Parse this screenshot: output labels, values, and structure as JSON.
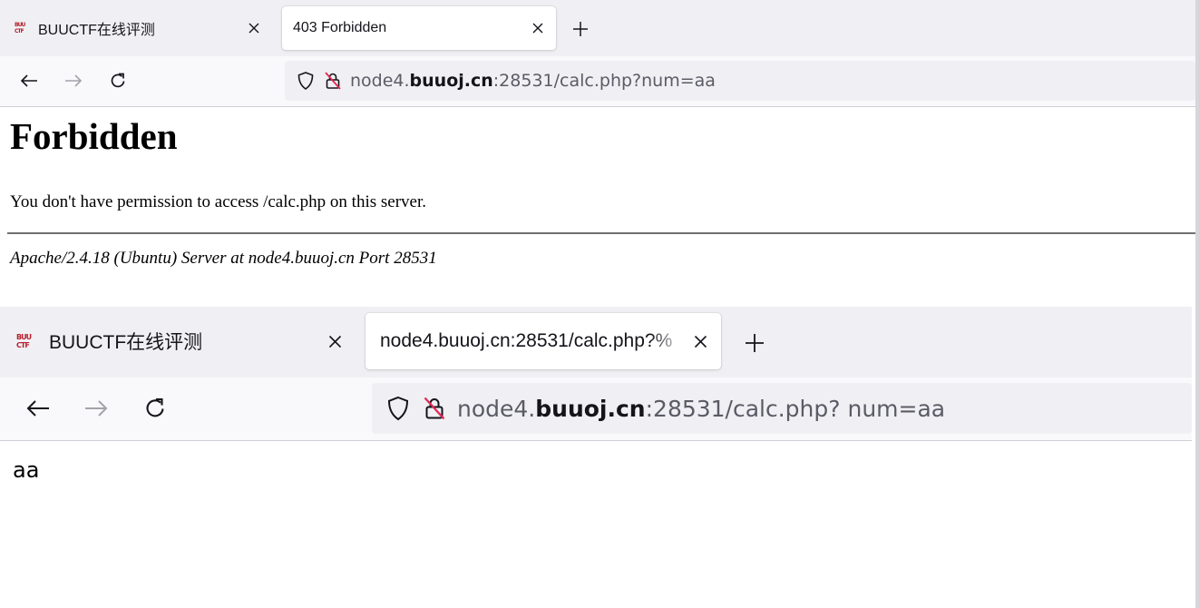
{
  "window1": {
    "tabs": [
      {
        "favicon": "BUU CTF",
        "title": "BUUCTF在线评测",
        "active": false
      },
      {
        "title": "403 Forbidden",
        "active": true
      }
    ],
    "urlbar": {
      "host_prefix": "node4.",
      "host_domain": "buuoj.cn",
      "host_rest": ":28531/calc.php?num=aa"
    },
    "page": {
      "heading": "Forbidden",
      "message": "You don't have permission to access /calc.php on this server.",
      "server_signature": "Apache/2.4.18 (Ubuntu) Server at node4.buuoj.cn Port 28531"
    }
  },
  "window2": {
    "tabs": [
      {
        "favicon": "BUU CTF",
        "title": "BUUCTF在线评测",
        "active": false
      },
      {
        "title": "node4.buuoj.cn:28531/calc.php?%",
        "active": true
      }
    ],
    "urlbar": {
      "host_prefix": "node4.",
      "host_domain": "buuoj.cn",
      "host_rest": ":28531/calc.php? num=aa"
    },
    "page": {
      "text": "aa"
    }
  },
  "icons": {
    "back": "arrow-left-icon",
    "forward": "arrow-right-icon",
    "reload": "reload-icon",
    "shield": "shield-icon",
    "insecure": "insecure-lock-icon",
    "close": "close-icon",
    "newtab": "plus-icon"
  },
  "colors": {
    "tabstrip": "#f0f0f4",
    "navbar": "#f9f9fb",
    "favicon": "#b51f2e",
    "insecure_slash": "#e22850",
    "url_text": "#5b5b66"
  }
}
